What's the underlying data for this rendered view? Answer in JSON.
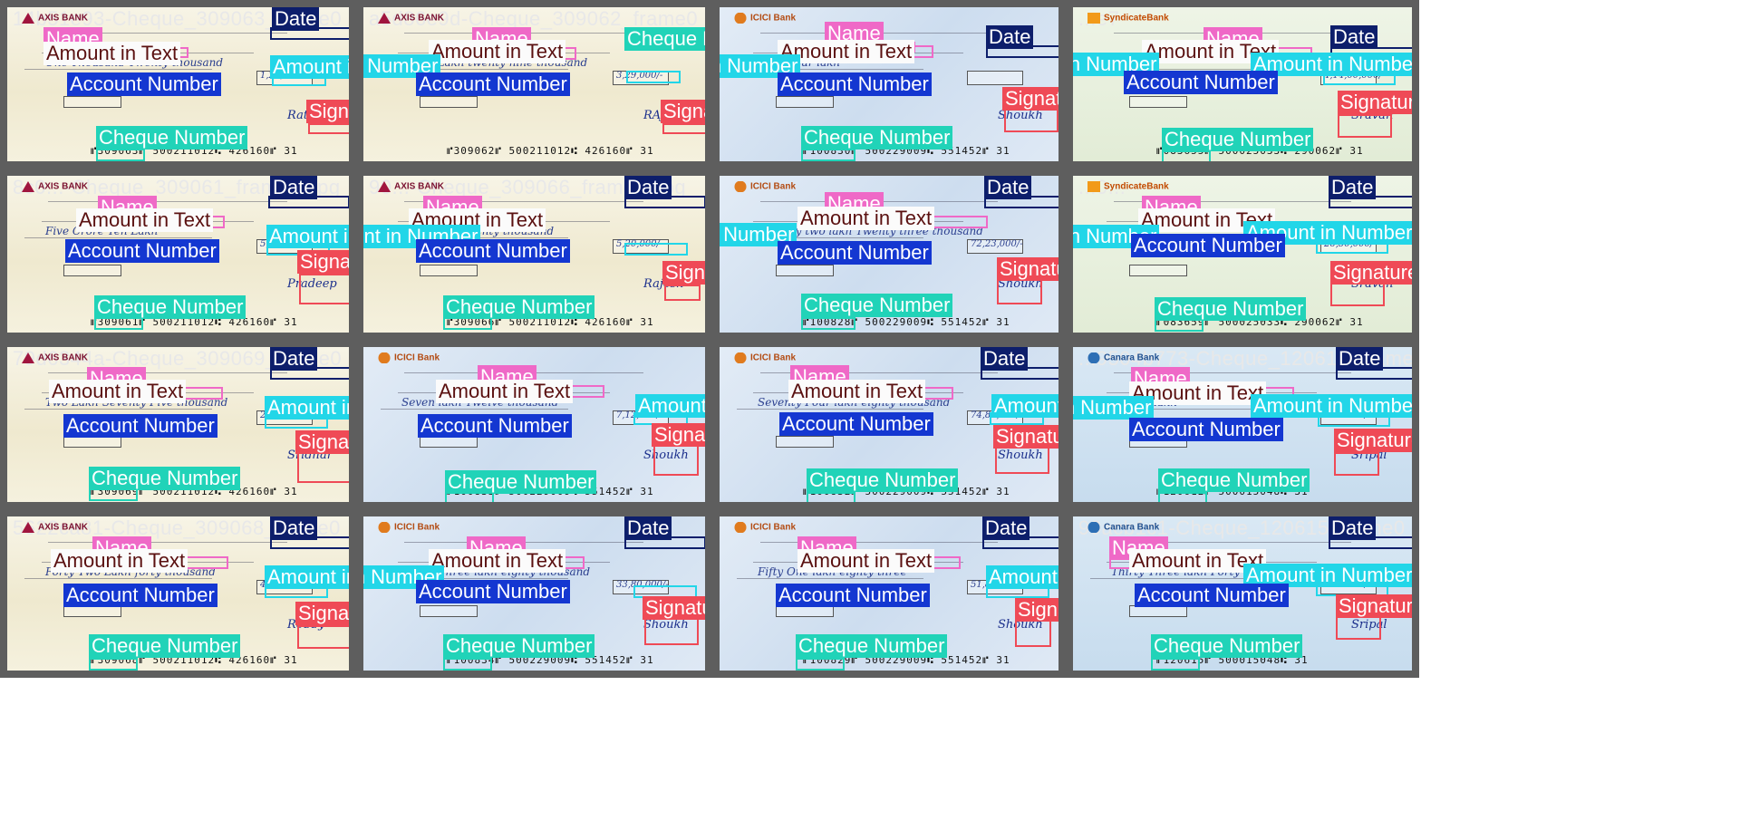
{
  "grid": {
    "cols": 4,
    "rows": 4,
    "separator_color": "#5e5e5e"
  },
  "label_colors": {
    "date": "#0d1e6b",
    "name": "#ef69c7",
    "amount_text": "#ef69c7",
    "amount_number": "#22d6e8",
    "account": "#1437d1",
    "signature": "#ef4a56",
    "cheque": "#21d3b8"
  },
  "label_text": {
    "date": "Date",
    "name": "Name",
    "amount_text": "Amount in Text",
    "amount_number": "Amount in Number",
    "account": "Account Number",
    "signature": "Signature",
    "cheque": "Cheque Number"
  },
  "tiles": [
    {
      "filename": "14b51e93-Cheque_309063_frame0_jpg",
      "bank": "AXIS BANK",
      "bank_style": "axis",
      "amount_words": "One Thousand Twenty thousand",
      "amount_figure": "1,20,000/-",
      "micr": "⑈309063⑈ 500211012⑆ 426160⑈ 31",
      "signature": "Rathod"
    },
    {
      "filename": "a5d86e9d-Cheque_309062_frame0_jpg",
      "bank": "AXIS BANK",
      "bank_style": "axis",
      "amount_words": "Three Lakh twenty nine thousand",
      "amount_figure": "3,29,000/-",
      "micr": "⑈309062⑈ 500211012⑆ 426160⑈ 31",
      "signature": "RAJESH PAL"
    },
    {
      "filename": "",
      "bank": "ICICI Bank",
      "bank_style": "icici",
      "amount_words": "crore four lakh",
      "amount_figure": "",
      "micr": "⑈100830⑈ 500229009⑆ 551452⑈ 31",
      "signature": "Shoukh"
    },
    {
      "filename": "...e7",
      "bank": "SyndicateBank",
      "bank_style": "syndicate",
      "amount_words": "",
      "amount_figure": "4,14,00,000/-",
      "micr": "⑈083655⑈ 500025033⑆ 290062⑈ 31",
      "signature": "Sravan"
    },
    {
      "filename": "8c0...-Cheque_309061_frame0_jpg",
      "bank": "AXIS BANK",
      "bank_style": "axis",
      "amount_words": "Five Crore Ten Lakh",
      "amount_figure": "5,10,00,000/-",
      "micr": "⑈309061⑈ 500211012⑆ 426160⑈ 31",
      "signature": "Pradeep"
    },
    {
      "filename": "90...-Cheque_309066_frame0_jpg",
      "bank": "AXIS BANK",
      "bank_style": "axis",
      "amount_words": "Five Lakh Twenty thousand",
      "amount_figure": "5,20,000/-",
      "micr": "⑈309066⑈ 500211012⑆ 426160⑈ 31",
      "signature": "Rajesh"
    },
    {
      "filename": "",
      "bank": "ICICI Bank",
      "bank_style": "icici",
      "amount_words": "Seventy two lakh Twenty three thousand",
      "amount_figure": "72,23,000/-",
      "micr": "⑈100828⑈ 500229009⑆ 551452⑈ 31",
      "signature": "Shoukh"
    },
    {
      "filename": "...0...",
      "bank": "SyndicateBank",
      "bank_style": "syndicate",
      "amount_words": "",
      "amount_figure": "26,50,000/-",
      "micr": "⑈083659⑈ 500025033⑆ 290062⑈ 31",
      "signature": "Sravan"
    },
    {
      "filename": "79d6344a-Cheque_309069_frame0_jpg",
      "bank": "AXIS BANK",
      "bank_style": "axis",
      "amount_words": "Two Lakh Seventy Five thousand",
      "amount_figure": "2,75,000/-",
      "micr": "⑈309069⑈ 500211012⑆ 426160⑈ 31",
      "signature": "Sridhar"
    },
    {
      "filename": "",
      "bank": "ICICI Bank",
      "bank_style": "icici",
      "amount_words": "Seven lakh Twelve thousand",
      "amount_figure": "7,12,000/-",
      "micr": "⑈100833⑈ 500229009⑆ 551452⑈ 31",
      "signature": "Shoukh"
    },
    {
      "filename": "",
      "bank": "ICICI Bank",
      "bank_style": "icici",
      "amount_words": "Seventy Four lakh eighty thousand",
      "amount_figure": "74,80,000/-",
      "micr": "⑈100832⑈ 500229009⑆ 551452⑈ 31",
      "signature": "Shoukh"
    },
    {
      "filename": "...9504b773-Cheque_120612_frame0_jpg",
      "bank": "Canara Bank",
      "bank_style": "canara",
      "amount_words": "Fifteen lakh",
      "amount_figure": "1500000/-",
      "micr": "⑈120612⑈ 500015048⑆ 31",
      "signature": "Sripal"
    },
    {
      "filename": "5622ca81-Cheque_309068_frame0_jpg",
      "bank": "AXIS BANK",
      "bank_style": "axis",
      "amount_words": "Forty Two Lakh forty thousand",
      "amount_figure": "42,40,000/-",
      "micr": "⑈309068⑈ 500211012⑆ 426160⑈ 31",
      "signature": "Reddy"
    },
    {
      "filename": "",
      "bank": "ICICI Bank",
      "bank_style": "icici",
      "amount_words": "Thirty Three lakh eighty thousand",
      "amount_figure": "33,80,000/-",
      "micr": "⑈100834⑈ 500229009⑆ 551452⑈ 31",
      "signature": "Shoukh"
    },
    {
      "filename": "",
      "bank": "ICICI Bank",
      "bank_style": "icici",
      "amount_words": "Fifty One lakh eighty three",
      "amount_figure": "51,83,000/-",
      "micr": "⑈100829⑈ 500229009⑆ 551452⑈ 31",
      "signature": "Shoukh"
    },
    {
      "filename": "90acb1c1-Cheque_120615_frame0_jpg",
      "bank": "Canara Bank",
      "bank_style": "canara",
      "amount_words": "Thirty Three lakh Forty",
      "amount_figure": "3340000/-",
      "micr": "⑈120615⑈ 500015048⑆ 31",
      "signature": "Sripal"
    }
  ]
}
